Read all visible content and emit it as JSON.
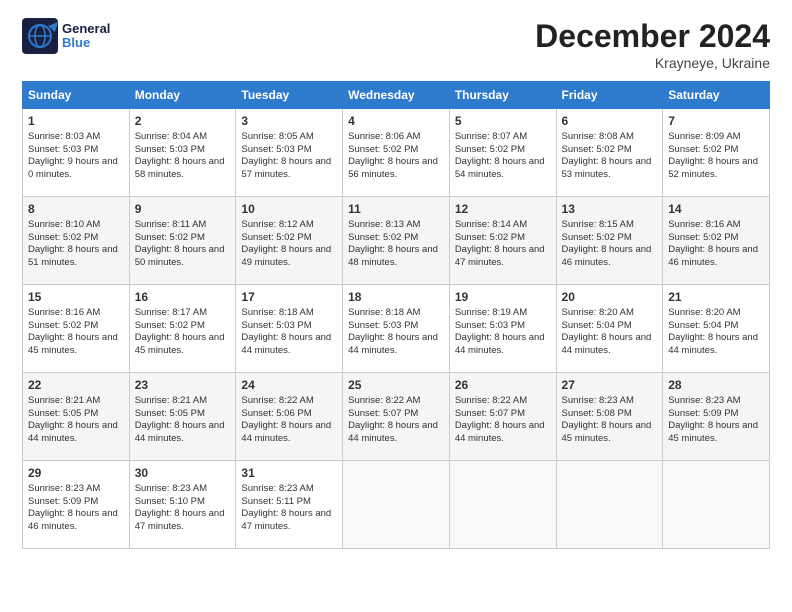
{
  "logo": {
    "line1": "General",
    "line2": "Blue"
  },
  "title": "December 2024",
  "subtitle": "Krayneye, Ukraine",
  "days_header": [
    "Sunday",
    "Monday",
    "Tuesday",
    "Wednesday",
    "Thursday",
    "Friday",
    "Saturday"
  ],
  "weeks": [
    [
      {
        "day": "1",
        "sunrise": "8:03 AM",
        "sunset": "5:03 PM",
        "daylight": "9 hours and 0 minutes."
      },
      {
        "day": "2",
        "sunrise": "8:04 AM",
        "sunset": "5:03 PM",
        "daylight": "8 hours and 58 minutes."
      },
      {
        "day": "3",
        "sunrise": "8:05 AM",
        "sunset": "5:03 PM",
        "daylight": "8 hours and 57 minutes."
      },
      {
        "day": "4",
        "sunrise": "8:06 AM",
        "sunset": "5:02 PM",
        "daylight": "8 hours and 56 minutes."
      },
      {
        "day": "5",
        "sunrise": "8:07 AM",
        "sunset": "5:02 PM",
        "daylight": "8 hours and 54 minutes."
      },
      {
        "day": "6",
        "sunrise": "8:08 AM",
        "sunset": "5:02 PM",
        "daylight": "8 hours and 53 minutes."
      },
      {
        "day": "7",
        "sunrise": "8:09 AM",
        "sunset": "5:02 PM",
        "daylight": "8 hours and 52 minutes."
      }
    ],
    [
      {
        "day": "8",
        "sunrise": "8:10 AM",
        "sunset": "5:02 PM",
        "daylight": "8 hours and 51 minutes."
      },
      {
        "day": "9",
        "sunrise": "8:11 AM",
        "sunset": "5:02 PM",
        "daylight": "8 hours and 50 minutes."
      },
      {
        "day": "10",
        "sunrise": "8:12 AM",
        "sunset": "5:02 PM",
        "daylight": "8 hours and 49 minutes."
      },
      {
        "day": "11",
        "sunrise": "8:13 AM",
        "sunset": "5:02 PM",
        "daylight": "8 hours and 48 minutes."
      },
      {
        "day": "12",
        "sunrise": "8:14 AM",
        "sunset": "5:02 PM",
        "daylight": "8 hours and 47 minutes."
      },
      {
        "day": "13",
        "sunrise": "8:15 AM",
        "sunset": "5:02 PM",
        "daylight": "8 hours and 46 minutes."
      },
      {
        "day": "14",
        "sunrise": "8:16 AM",
        "sunset": "5:02 PM",
        "daylight": "8 hours and 46 minutes."
      }
    ],
    [
      {
        "day": "15",
        "sunrise": "8:16 AM",
        "sunset": "5:02 PM",
        "daylight": "8 hours and 45 minutes."
      },
      {
        "day": "16",
        "sunrise": "8:17 AM",
        "sunset": "5:02 PM",
        "daylight": "8 hours and 45 minutes."
      },
      {
        "day": "17",
        "sunrise": "8:18 AM",
        "sunset": "5:03 PM",
        "daylight": "8 hours and 44 minutes."
      },
      {
        "day": "18",
        "sunrise": "8:18 AM",
        "sunset": "5:03 PM",
        "daylight": "8 hours and 44 minutes."
      },
      {
        "day": "19",
        "sunrise": "8:19 AM",
        "sunset": "5:03 PM",
        "daylight": "8 hours and 44 minutes."
      },
      {
        "day": "20",
        "sunrise": "8:20 AM",
        "sunset": "5:04 PM",
        "daylight": "8 hours and 44 minutes."
      },
      {
        "day": "21",
        "sunrise": "8:20 AM",
        "sunset": "5:04 PM",
        "daylight": "8 hours and 44 minutes."
      }
    ],
    [
      {
        "day": "22",
        "sunrise": "8:21 AM",
        "sunset": "5:05 PM",
        "daylight": "8 hours and 44 minutes."
      },
      {
        "day": "23",
        "sunrise": "8:21 AM",
        "sunset": "5:05 PM",
        "daylight": "8 hours and 44 minutes."
      },
      {
        "day": "24",
        "sunrise": "8:22 AM",
        "sunset": "5:06 PM",
        "daylight": "8 hours and 44 minutes."
      },
      {
        "day": "25",
        "sunrise": "8:22 AM",
        "sunset": "5:07 PM",
        "daylight": "8 hours and 44 minutes."
      },
      {
        "day": "26",
        "sunrise": "8:22 AM",
        "sunset": "5:07 PM",
        "daylight": "8 hours and 44 minutes."
      },
      {
        "day": "27",
        "sunrise": "8:23 AM",
        "sunset": "5:08 PM",
        "daylight": "8 hours and 45 minutes."
      },
      {
        "day": "28",
        "sunrise": "8:23 AM",
        "sunset": "5:09 PM",
        "daylight": "8 hours and 45 minutes."
      }
    ],
    [
      {
        "day": "29",
        "sunrise": "8:23 AM",
        "sunset": "5:09 PM",
        "daylight": "8 hours and 46 minutes."
      },
      {
        "day": "30",
        "sunrise": "8:23 AM",
        "sunset": "5:10 PM",
        "daylight": "8 hours and 47 minutes."
      },
      {
        "day": "31",
        "sunrise": "8:23 AM",
        "sunset": "5:11 PM",
        "daylight": "8 hours and 47 minutes."
      },
      null,
      null,
      null,
      null
    ]
  ],
  "labels": {
    "sunrise": "Sunrise:",
    "sunset": "Sunset:",
    "daylight": "Daylight:"
  }
}
